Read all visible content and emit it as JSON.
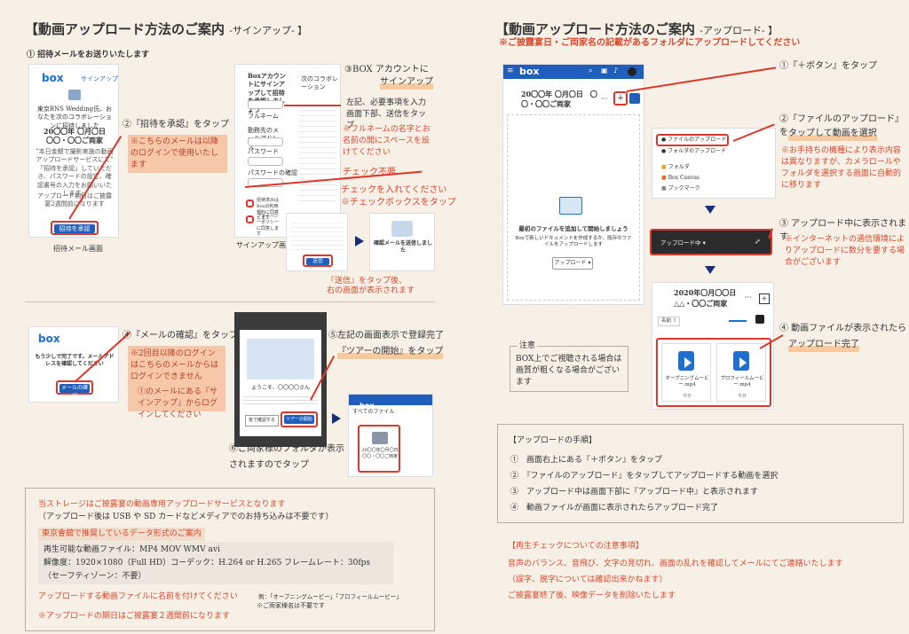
{
  "left": {
    "title": "【動画アップロード方法のご案内",
    "title_sub": "-サインアップ- 】",
    "step1": "① 招待メールをお送りいたします",
    "invite_phone": {
      "logo": "box",
      "header_right": "サインアップ",
      "body": "東京BNS Wedding氏、おなたを次のコラボレーションに招待しました",
      "date": "20〇〇年 〇月〇日",
      "name": "〇〇・〇〇ご両家",
      "msg": "\"本日金額で撮影実施の動画アップロードサービスにて\" 「招待を承認」していただき、パスワードの設定、確認書号の入力をお願いいたします。",
      "note": "アップロード期日はご披露宴2週間前になります",
      "button": "招待を承認",
      "caption": "招待メール画面"
    },
    "step2": "②『招待を承認』をタップ",
    "step2_note": "※こちらのメールは以降のログインで使用いたします",
    "signup_phone": {
      "heading": "Boxアカウントにサインアップして招待を承認しましょう",
      "right_col": "次のコラボレーション",
      "fields": [
        "フルネーム",
        "勤務先のメールアドレス",
        "パスワード",
        "パスワードの確認"
      ],
      "caption": "サインアップ画面",
      "check1": "招待済みはBoxの利用規約に同意します",
      "check2": "プライバシーポリシーに同意します"
    },
    "step3": "③BOX アカウントに",
    "step3b": "サインアップ",
    "step3_text": "左記、必要事項を入力画面下部、送信をタップ",
    "step3_note": "※フルネームの名字とお名前の間にスペースを設けてください",
    "check_unneeded": "チェック不要",
    "check_needed": "チェックを入れてください",
    "check_box_note": "※チェックボックスをタップ",
    "send_note_1": "『送信』をタップ後、",
    "send_note_2": "右の画面が表示されます",
    "confirm_screen": {
      "text": "確認メールを送信しました",
      "btn": "送信"
    },
    "mail_phone": {
      "logo": "box",
      "text": "もう少しで完了です。メールアドレスを確認してください",
      "button": "メールの確認"
    },
    "step4": "④『メールの確認』をタップ",
    "step4_note_1": "※2回目以降のログインはこちらのメールからはログインできません",
    "step4_note_2": "①のメールにある『サインアップ』からログインしてください",
    "tour_phone": {
      "welcome": "ようこそ、〇〇〇〇さん",
      "btn_left": "後で確認する",
      "btn_right": "ツアーの開始"
    },
    "step5": "⑤左記の画面表示で登録完了",
    "step5b": "『ツアーの開始』をタップ",
    "folder_phone": {
      "logo": "box",
      "label": "すべてのファイル",
      "folder": "20〇〇年〇月〇日 〇〇・〇〇ご両家"
    },
    "step6": "⑥ご両家様のフォルダが表示",
    "step6b": "されますのでタップ",
    "info": {
      "line1": "当ストレージはご披露宴の動画専用アップロードサービスとなります",
      "line2": "（アップロード後は USB や SD カードなどメディアでのお持ち込みは不要です）",
      "heading": "東京會舘で推奨しているデータ形式のご案内",
      "format1": "再生可能な動画ファイル：MP4  MOV  WMV  avi",
      "format2": "解像度：1920×1080（Full HD）コーデック：H.264 or H.265  フレームレート：30fps",
      "format3": "（セーフティゾーン：不要）",
      "name_note": "アップロードする動画ファイルに名前を付けてください",
      "name_example": "例：「オープニングムービー」「プロフィールムービー」",
      "name_example2": "※ご両家様名は不要です",
      "deadline": "※アップロードの期日はご披露宴２週間前になります"
    }
  },
  "right": {
    "title": "【動画アップロード方法のご案内",
    "title_sub": "-アップロード- 】",
    "subtitle": "※ご披露宴日・ご両家名の記載があるフォルダにアップロードしてください",
    "main_phone": {
      "logo": "box",
      "folder_title": "20〇〇年 〇月〇日　〇〇・〇〇ご両家",
      "empty_title": "最初のファイルを追加して開始しましょう",
      "empty_text": "Boxで新しいドキュメントを作成するか、既存のファイルをアップロードします",
      "upload_btn": "アップロード ▾"
    },
    "s1": "①『＋ボタン』をタップ",
    "menu": {
      "items": [
        "ファイルのアップロード",
        "フォルダのアップロード",
        "フォルダ",
        "Box Canvas",
        "ブックマーク"
      ]
    },
    "s2": "②『ファイルのアップロード』を",
    "s2b": "タップして動画を選択",
    "s2_note": "※お手持ちの機種により表示内容は異なりますが、カメラロールやフォルダを選択する画面に自動的に移ります",
    "upload_bar": "アップロード中",
    "s3": "③ アップロード中に表示されます",
    "s3_note": "※インターネットの通信環境によりアップロードに数分を要する場合がございます",
    "result_phone": {
      "folder_title": "2020年〇月〇〇日",
      "folder_title2": "△△・〇〇ご両家",
      "sort": "名前 ↑",
      "files": [
        {
          "name": "オープニングムービー.mp4",
          "meta": "今日"
        },
        {
          "name": "プロフィールムービー.mp4",
          "meta": "今日"
        }
      ]
    },
    "s4": "④ 動画ファイルが表示されたら",
    "s4b": "アップロード完了",
    "caution_label": "注意",
    "caution_text": "BOX上でご視聴される場合は画質が粗くなる場合がございます",
    "procedure": {
      "heading": "【アップロードの手順】",
      "steps": [
        "①　画面右上にある『＋ボタン』をタップ",
        "②　『ファイルのアップロード』をタップしてアップロードする動画を選択",
        "③　アップロード中は画面下部に『アップロード中』と表示されます",
        "④　動画ファイルが画面に表示されたらアップロード完了"
      ]
    },
    "check": {
      "heading": "【再生チェックについての注意事項】",
      "line1": "音声のバランス、音飛び、文字の見切れ、画面の乱れを確認してメールにてご連絡いたします",
      "line2": "（誤字、脱字については確認出来かねます）",
      "line3": "ご披露宴終了後、映像データを削除いたします"
    }
  },
  "colors": {
    "accent": "#d9482b",
    "box_blue": "#1f6fd1",
    "navy": "#1a2e77"
  }
}
